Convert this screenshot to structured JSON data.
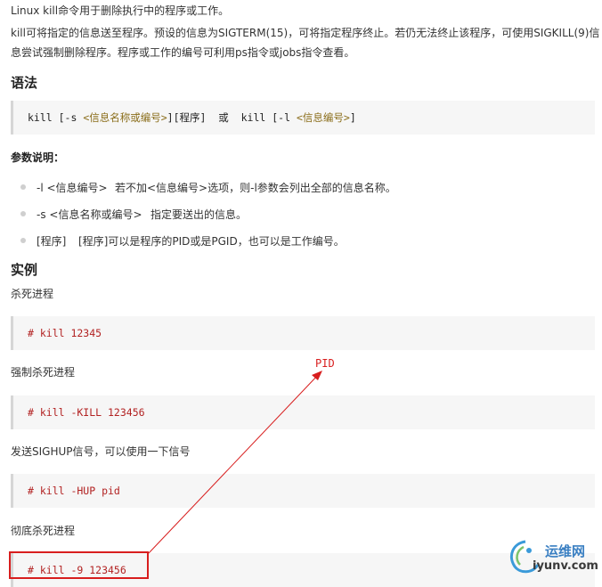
{
  "intro": {
    "line1": "Linux kill命令用于删除执行中的程序或工作。",
    "line2": "kill可将指定的信息送至程序。预设的信息为SIGTERM(15)，可将指定程序终止。若仍无法终止该程序，可使用SIGKILL(9)信",
    "line3": "息尝试强制删除程序。程序或工作的编号可利用ps指令或jobs指令查看。"
  },
  "syntax": {
    "heading": "语法",
    "code_parts": {
      "a": "kill [-s ",
      "b": "<信息名称或编号>",
      "c": "][程序]  或  kill [-l ",
      "d": "<信息编号>",
      "e": "]"
    }
  },
  "params": {
    "heading": "参数说明：",
    "items": [
      {
        "flag": "-l <信息编号>",
        "desc": "若不加<信息编号>选项，则-l参数会列出全部的信息名称。"
      },
      {
        "flag": "-s <信息名称或编号>",
        "desc": "指定要送出的信息。"
      },
      {
        "flag": "[程序]",
        "desc": "[程序]可以是程序的PID或是PGID，也可以是工作编号。"
      }
    ]
  },
  "examples": {
    "heading": "实例",
    "items": [
      {
        "caption": "杀死进程",
        "code": "# kill 12345"
      },
      {
        "caption": "强制杀死进程",
        "code": "# kill -KILL 123456"
      },
      {
        "caption": "发送SIGHUP信号，可以使用一下信号",
        "code": "# kill -HUP pid"
      },
      {
        "caption": "彻底杀死进程",
        "code": "# kill -9 123456"
      }
    ]
  },
  "annotation": {
    "label": "PID",
    "color": "#d81e1e"
  },
  "watermark": {
    "text1": "运维网",
    "text2": "iyunv.com",
    "brand_color": "#3a7fc2"
  },
  "colors": {
    "code_bg": "#f6f6f6",
    "code_border": "#d6d6d6",
    "comment": "#b22222"
  }
}
